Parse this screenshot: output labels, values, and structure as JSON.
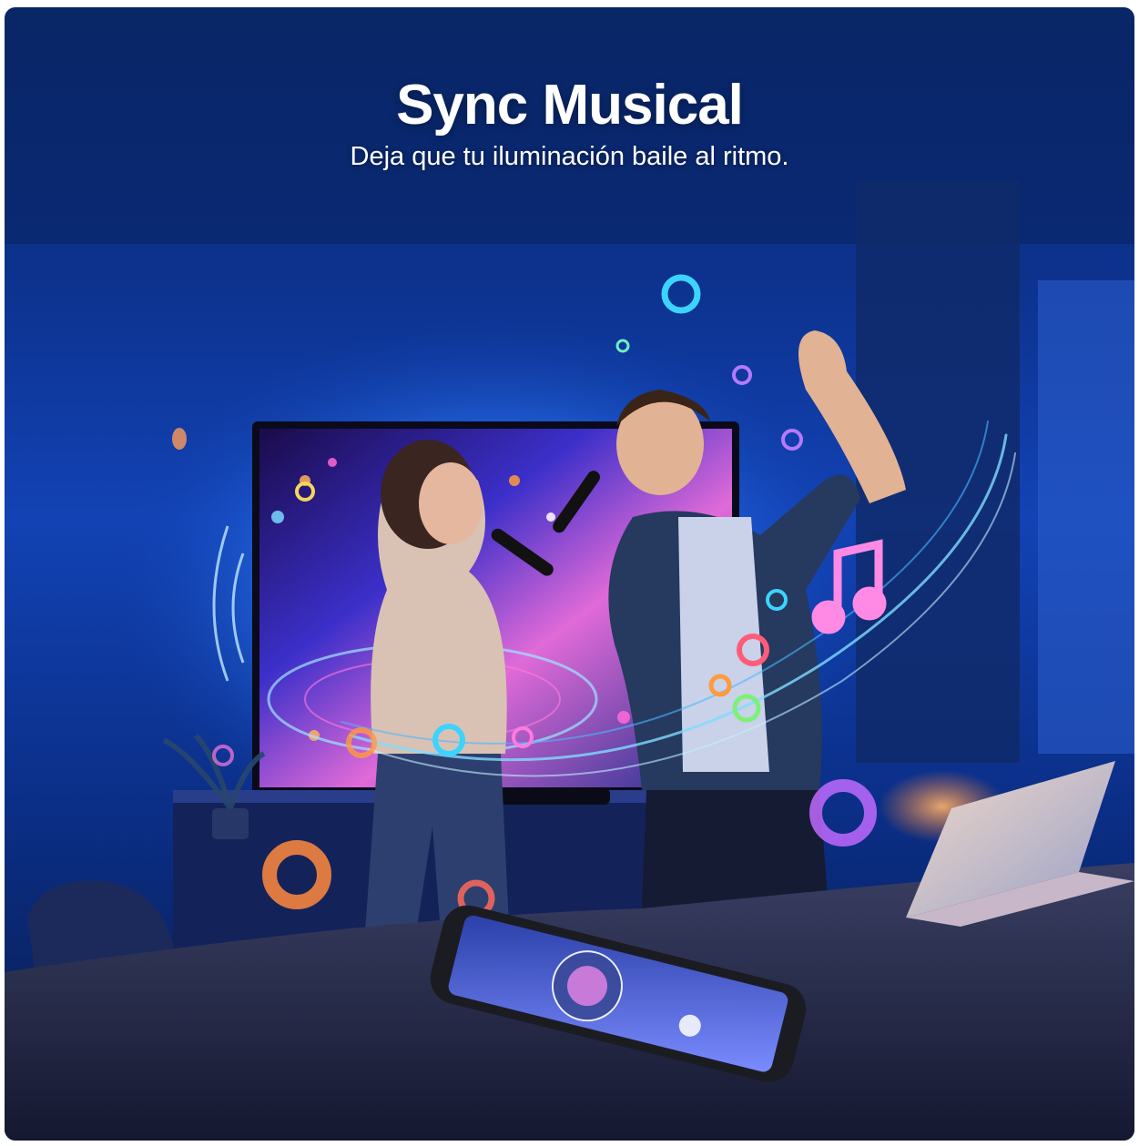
{
  "hero": {
    "title": "Sync Musical",
    "subtitle": "Deja que tu iluminación baile al ritmo."
  },
  "colors": {
    "wall": "#1242b4",
    "backlight": "#4aa8ff",
    "accent_pink": "#ff4fd8",
    "accent_orange": "#ff8a3d",
    "accent_cyan": "#22d3ee"
  }
}
